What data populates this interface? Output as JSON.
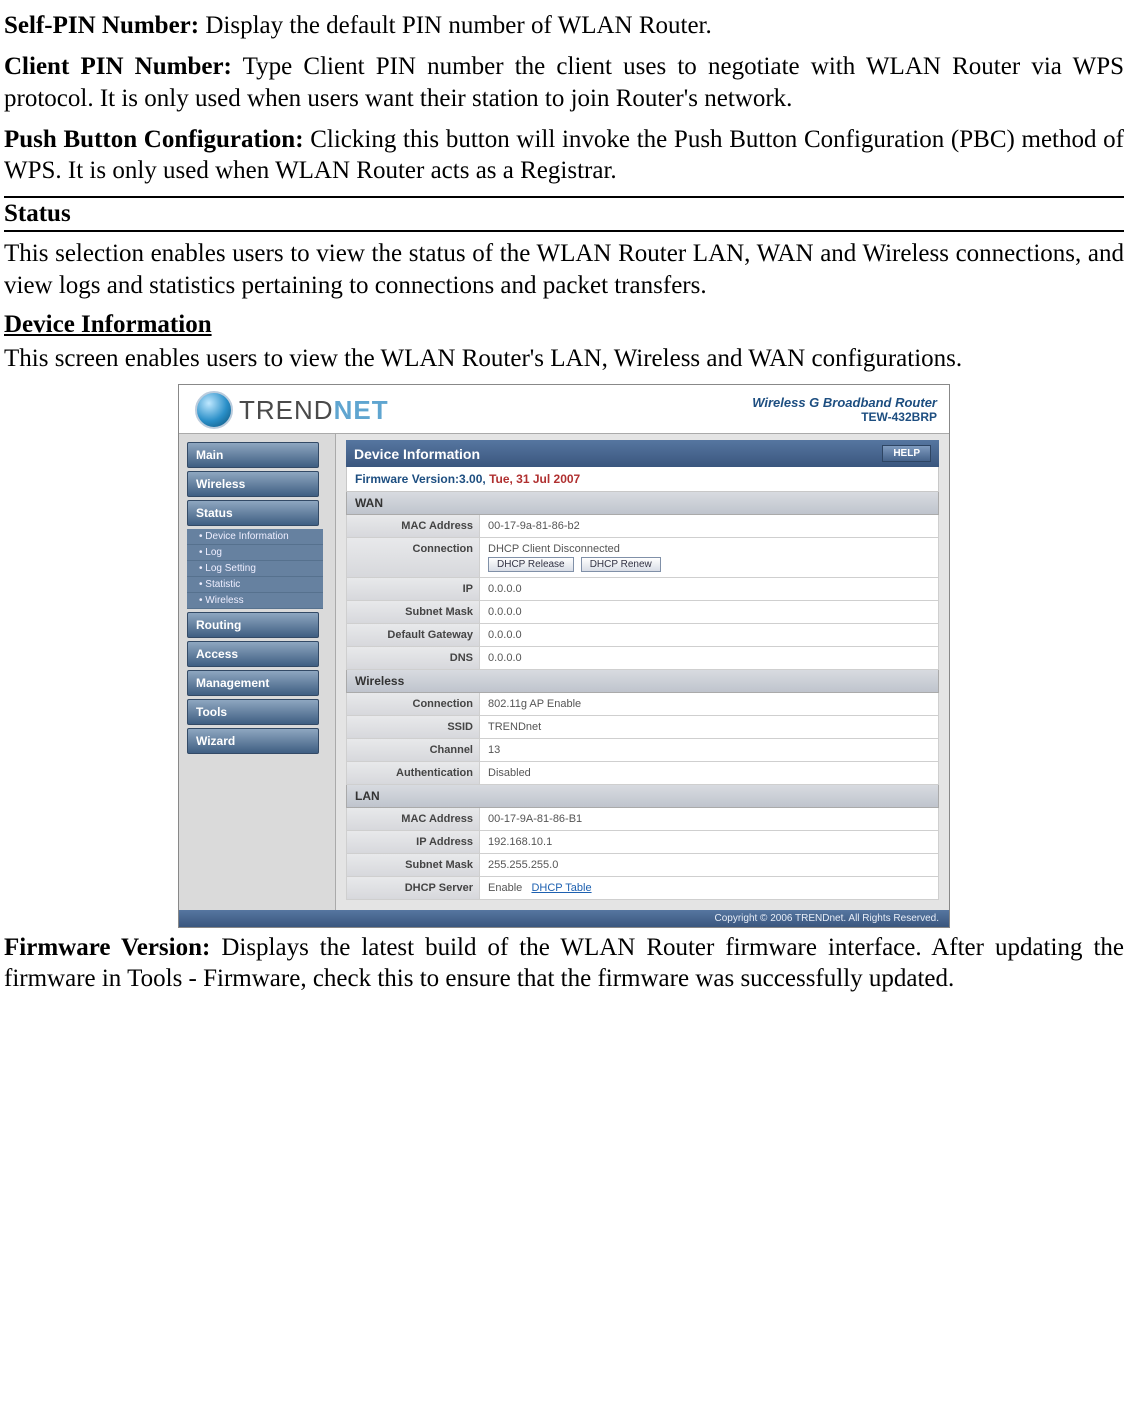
{
  "intro": {
    "selfpin_lbl": "Self-PIN Number:",
    "selfpin_txt": " Display the default PIN number of WLAN Router.",
    "clientpin_lbl": "Client PIN Number:",
    "clientpin_txt": " Type Client PIN number the client uses to negotiate with WLAN Router via WPS protocol. It is only used when users want their station to join Router's network.",
    "pbc_lbl": "Push Button Configuration:",
    "pbc_txt": " Clicking this button will invoke the Push Button Configuration (PBC) method of WPS. It is only used when WLAN Router acts as a Registrar."
  },
  "sections": {
    "status_head": "Status",
    "status_txt": "This selection enables users to view the status of the WLAN Router LAN, WAN and Wireless connections, and view logs and statistics pertaining to connections and packet transfers.",
    "devinfo_head": "Device Information",
    "devinfo_txt": "This screen enables users to view the WLAN Router's LAN, Wireless and WAN configurations."
  },
  "router": {
    "brand_t": "TR",
    "brand_e": "E",
    "brand_nd": "ND",
    "brand_net": "NET",
    "model_line1": "Wireless G Broadband Router",
    "model_line2": "TEW-432BRP",
    "nav": {
      "main": "Main",
      "wireless": "Wireless",
      "status": "Status",
      "sub_devinfo": "• Device Information",
      "sub_log": "• Log",
      "sub_logset": "• Log Setting",
      "sub_stat": "• Statistic",
      "sub_wl": "• Wireless",
      "routing": "Routing",
      "access": "Access",
      "mgmt": "Management",
      "tools": "Tools",
      "wizard": "Wizard"
    },
    "panel_title": "Device Information",
    "help": "HELP",
    "fw_label": "Firmware Version:3.00,",
    "fw_date": " Tue, 31 Jul 2007",
    "wan": {
      "head": "WAN",
      "mac_lbl": "MAC Address",
      "mac": "00-17-9a-81-86-b2",
      "conn_lbl": "Connection",
      "conn_state": "DHCP Client Disconnected",
      "btn_rel": "DHCP Release",
      "btn_ren": "DHCP Renew",
      "ip_lbl": "IP",
      "ip": "0.0.0.0",
      "mask_lbl": "Subnet Mask",
      "mask": "0.0.0.0",
      "gw_lbl": "Default Gateway",
      "gw": "0.0.0.0",
      "dns_lbl": "DNS",
      "dns": "0.0.0.0"
    },
    "wl": {
      "head": "Wireless",
      "conn_lbl": "Connection",
      "conn": "802.11g AP Enable",
      "ssid_lbl": "SSID",
      "ssid": "TRENDnet",
      "chan_lbl": "Channel",
      "chan": "13",
      "auth_lbl": "Authentication",
      "auth": "Disabled"
    },
    "lan": {
      "head": "LAN",
      "mac_lbl": "MAC Address",
      "mac": "00-17-9A-81-86-B1",
      "ip_lbl": "IP Address",
      "ip": "192.168.10.1",
      "mask_lbl": "Subnet Mask",
      "mask": "255.255.255.0",
      "dhcp_lbl": "DHCP Server",
      "dhcp_state": "Enable",
      "dhcp_link": "DHCP Table"
    },
    "footer": "Copyright © 2006 TRENDnet. All Rights Reserved."
  },
  "outro": {
    "fw_lbl": "Firmware Version:",
    "fw_txt": " Displays the latest build of the WLAN Router firmware interface. After updating the firmware in Tools - Firmware, check this to ensure that the firmware was successfully updated."
  }
}
